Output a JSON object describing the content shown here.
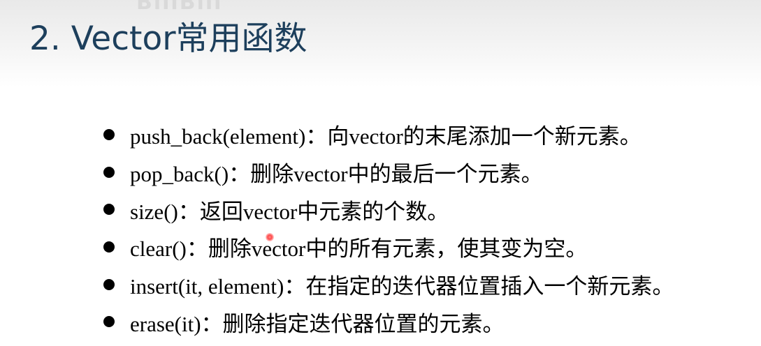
{
  "slide": {
    "watermark": "BiliBili",
    "title": "2. Vector常用函数",
    "bullets": [
      {
        "text": "push_back(element)：向vector的末尾添加一个新元素。"
      },
      {
        "text": "pop_back()：删除vector中的最后一个元素。"
      },
      {
        "text": "size()：返回vector中元素的个数。"
      },
      {
        "text": "clear()：删除vector中的所有元素，使其变为空。"
      },
      {
        "text": "insert(it, element)：在指定的迭代器位置插入一个新元素。"
      },
      {
        "text": "erase(it)：删除指定迭代器位置的元素。"
      }
    ]
  },
  "colors": {
    "title": "#1d3f5c",
    "bullet_text": "#000000",
    "cursor": "#ff4a4a"
  }
}
